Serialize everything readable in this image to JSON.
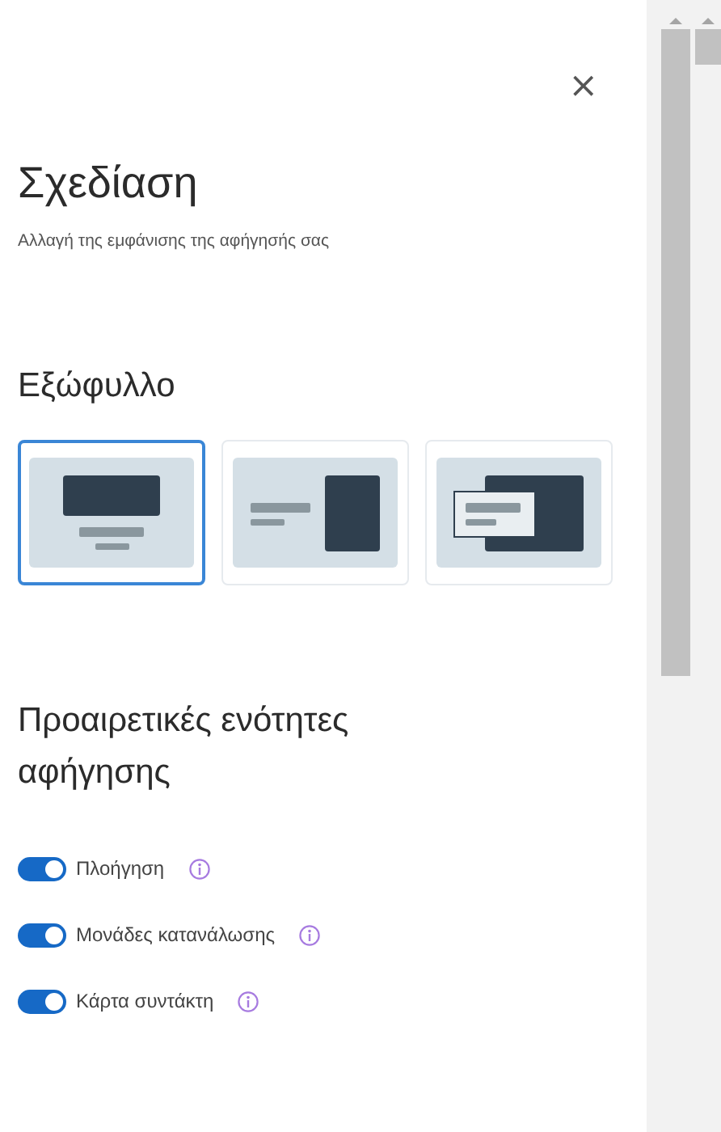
{
  "close": "×",
  "title": "Σχεδίαση",
  "subtitle": "Αλλαγή της εμφάνισης της αφήγησής σας",
  "cover": {
    "heading": "Εξώφυλλο",
    "layouts": [
      {
        "kind": "centered",
        "selected": true
      },
      {
        "kind": "side",
        "selected": false
      },
      {
        "kind": "overlay",
        "selected": false
      }
    ]
  },
  "sections": {
    "heading": "Προαιρετικές ενότητες αφήγησης",
    "toggles": [
      {
        "label": "Πλοήγηση",
        "on": true
      },
      {
        "label": "Μονάδες κατανάλωσης",
        "on": true
      },
      {
        "label": "Κάρτα συντάκτη",
        "on": true
      }
    ]
  }
}
